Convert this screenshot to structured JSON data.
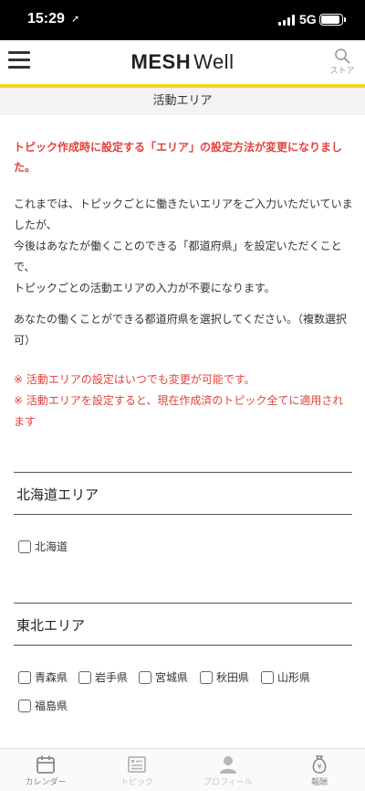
{
  "status_bar": {
    "time": "15:29",
    "location_glyph": "➚",
    "network": "5G"
  },
  "header": {
    "logo_bold": "MESH",
    "logo_light": "Well",
    "store_label": "ストア"
  },
  "page_title": "活動エリア",
  "notice": {
    "headline": "トピック作成時に設定する「エリア」の設定方法が変更になりました。",
    "p1_line1": "これまでは、トピックごとに働きたいエリアをご入力いただいていましたが、",
    "p1_line2": "今後はあなたが働くことのできる「都道府県」を設定いただくことで、",
    "p1_line3": "トピックごとの活動エリアの入力が不要になります。",
    "p2": "あなたの働くことができる都道府県を選択してください。（複数選択可）",
    "note1": "※ 活動エリアの設定はいつでも変更が可能です。",
    "note2": "※ 活動エリアを設定すると、現在作成済のトピック全てに適用されます"
  },
  "regions": [
    {
      "title": "北海道エリア",
      "prefectures": [
        "北海道"
      ]
    },
    {
      "title": "東北エリア",
      "prefectures": [
        "青森県",
        "岩手県",
        "宮城県",
        "秋田県",
        "山形県",
        "福島県"
      ]
    }
  ],
  "bottom_nav": [
    {
      "label": "カレンダー",
      "icon": "calendar-icon"
    },
    {
      "label": "トピック",
      "icon": "list-icon"
    },
    {
      "label": "プロフィール",
      "icon": "person-icon"
    },
    {
      "label": "報酬",
      "icon": "money-bag-icon"
    }
  ],
  "colors": {
    "accent": "#f5d41a",
    "alert_red": "#e2433d"
  }
}
